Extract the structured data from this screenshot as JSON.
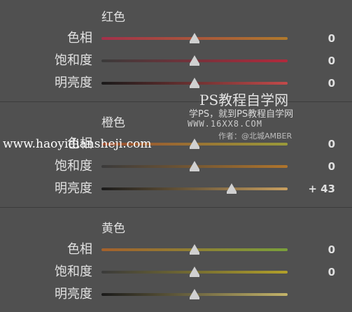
{
  "sections": [
    {
      "title": "红色",
      "rows": [
        {
          "label": "色相",
          "value": "0",
          "level": 0.5,
          "track": [
            "#a3304a",
            "#b07a2c"
          ]
        },
        {
          "label": "饱和度",
          "value": "0",
          "level": 0.5,
          "track": [
            "#3a3a3a",
            "#b22a3c"
          ]
        },
        {
          "label": "明亮度",
          "value": "0",
          "level": 0.5,
          "track": [
            "#1a1a1a",
            "#c24a4a"
          ]
        }
      ]
    },
    {
      "title": "橙色",
      "rows": [
        {
          "label": "色相",
          "value": "0",
          "level": 0.5,
          "track": [
            "#9a4b2d",
            "#9a9a3a"
          ]
        },
        {
          "label": "饱和度",
          "value": "0",
          "level": 0.5,
          "track": [
            "#3a3a3a",
            "#b0752c"
          ]
        },
        {
          "label": "明亮度",
          "value": "+ 43",
          "level": 0.7,
          "track": [
            "#1a1a1a",
            "#c9a060"
          ]
        }
      ]
    },
    {
      "title": "黄色",
      "rows": [
        {
          "label": "色相",
          "value": "0",
          "level": 0.5,
          "track": [
            "#a4612c",
            "#7aa03a"
          ]
        },
        {
          "label": "饱和度",
          "value": "0",
          "level": 0.5,
          "track": [
            "#3a3a3a",
            "#b2a02a"
          ]
        },
        {
          "label": "明亮度",
          "value": "",
          "level": 0.5,
          "track": [
            "#1a1a1a",
            "#c4b46a"
          ]
        }
      ]
    }
  ],
  "watermarks": {
    "line1": "PS教程自学网",
    "line2": "学PS，就到PS教程自学网",
    "line3": "WWW.16XX8.COM",
    "line4": "作者：@北城AMBER",
    "site": "www.haoyidiansheji.com"
  }
}
